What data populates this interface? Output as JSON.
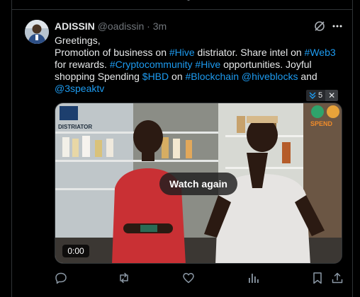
{
  "tweet": {
    "author_name": "ADISSIN",
    "handle": "@oadissin",
    "separator": "·",
    "time": "3m",
    "body": {
      "line1": "Greetings,",
      "line2_prefix": "Promotion of  business on ",
      "line2_tag1": "#Hive",
      "line2_mid": " distriator. Share intel on ",
      "line2_tag2": "#Web3",
      "line3_prefix": "for rewards. ",
      "line3_tag1": "#Cryptocommunity",
      "line3_sep": " ",
      "line3_tag2": "#Hive",
      "line3_suffix": " opportunities. Joyful",
      "line4_prefix": "shopping Spending ",
      "line4_tag1": "$HBD",
      "line4_mid1": " on ",
      "line4_tag2": "#Blockchain",
      "line4_sep": " ",
      "line4_tag3": "@hiveblocks",
      "line4_suffix": " and",
      "line5_tag": "@3speaktv"
    },
    "more_badge_count": "5",
    "more_badge_close": "✕",
    "media": {
      "overlay_button": "Watch again",
      "timestamp": "0:00",
      "sign_text": "DISTRIATOR",
      "spend_text": "SPEND"
    }
  },
  "colors": {
    "background": "#000000",
    "text": "#e7e9ea",
    "muted": "#71767b",
    "link": "#1d9bf0",
    "border": "#2f3336"
  },
  "icons": [
    "grok-icon",
    "more-icon",
    "reply-icon",
    "repost-icon",
    "like-icon",
    "views-icon",
    "bookmark-icon",
    "share-icon"
  ]
}
